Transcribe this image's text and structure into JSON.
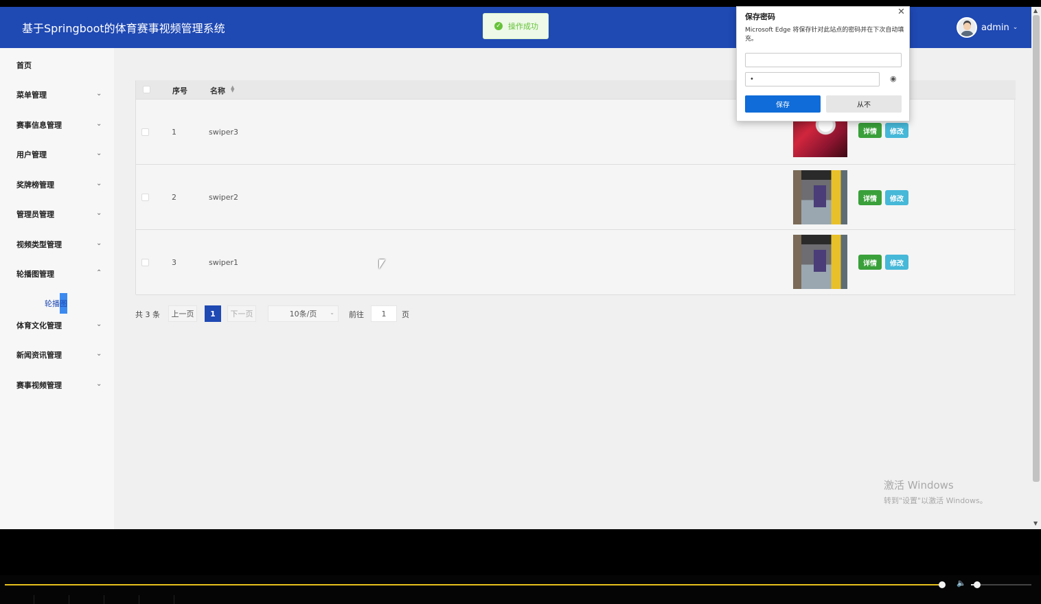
{
  "header": {
    "title": "基于Springboot的体育赛事视频管理系统",
    "toast": "操作成功",
    "username": "admin"
  },
  "sidebar": {
    "items": [
      {
        "label": "首页",
        "chevron": ""
      },
      {
        "label": "菜单管理",
        "chevron": "⌄"
      },
      {
        "label": "赛事信息管理",
        "chevron": "⌄"
      },
      {
        "label": "用户管理",
        "chevron": "⌄"
      },
      {
        "label": "奖牌榜管理",
        "chevron": "⌄"
      },
      {
        "label": "管理员管理",
        "chevron": "⌄"
      },
      {
        "label": "视频类型管理",
        "chevron": "⌄"
      },
      {
        "label": "轮播图管理",
        "chevron": "⌃"
      },
      {
        "label": "体育文化管理",
        "chevron": "⌄"
      },
      {
        "label": "新闻资讯管理",
        "chevron": "⌄"
      },
      {
        "label": "赛事视频管理",
        "chevron": "⌄"
      }
    ],
    "submenu": {
      "label_a": "轮播",
      "label_b": "图"
    }
  },
  "table": {
    "headers": {
      "index": "序号",
      "name": "名称"
    },
    "rows": [
      {
        "index": "1",
        "name": "swiper3",
        "detail": "详情",
        "edit": "修改"
      },
      {
        "index": "2",
        "name": "swiper2",
        "detail": "详情",
        "edit": "修改"
      },
      {
        "index": "3",
        "name": "swiper1",
        "detail": "详情",
        "edit": "修改"
      }
    ]
  },
  "pagination": {
    "total": "共 3 条",
    "prev": "上一页",
    "current": "1",
    "next": "下一页",
    "page_size": "10条/页",
    "goto_label": "前往",
    "goto_value": "1",
    "goto_unit": "页"
  },
  "password_dialog": {
    "title": "保存密码",
    "description": "Microsoft Edge 将保存针对此站点的密码并在下次自动填充。",
    "username_value": "",
    "password_value": "•",
    "save": "保存",
    "never": "从不"
  },
  "watermark": {
    "line1": "激活 Windows",
    "line2": "转到\"设置\"以激活 Windows。"
  },
  "player": {
    "progress": 0.9,
    "volume": 0.07
  },
  "colors": {
    "header_bg": "#1f49b3",
    "detail_button": "#3aa03a",
    "edit_button": "#46b8d8",
    "progress_bar": "#e9c21d",
    "edge_save": "#0f6cd8"
  },
  "icons": {
    "toast": "check-circle-icon",
    "sort": "sort-icon",
    "eye": "eye-icon",
    "close": "close-icon",
    "volume": "volume-icon"
  }
}
